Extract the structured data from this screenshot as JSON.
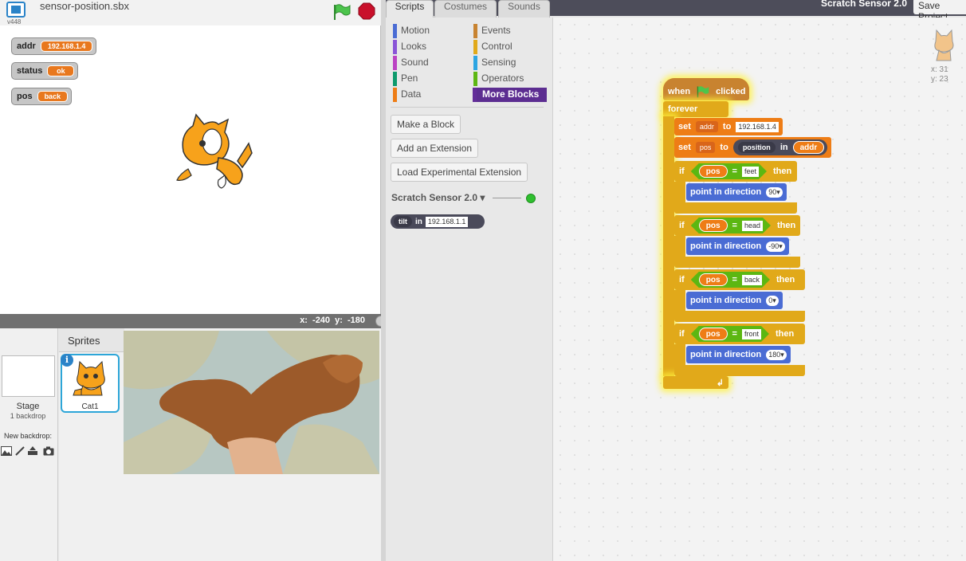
{
  "stage_panel": {
    "project_title": "sensor-position.sbx",
    "version": "v448",
    "monitors": [
      {
        "name": "addr",
        "value": "192.168.1.4"
      },
      {
        "name": "status",
        "value": "ok"
      },
      {
        "name": "pos",
        "value": "back"
      }
    ],
    "coords": {
      "x_label": "x:",
      "x": "-240",
      "y_label": "y:",
      "y": "-180"
    }
  },
  "sprites_pane": {
    "stage_label": "Stage",
    "stage_backdrops": "1 backdrop",
    "new_backdrop_label": "New backdrop:",
    "sprites_label": "Sprites",
    "info_glyph": "i",
    "sprite_name": "Cat1"
  },
  "tabs": [
    "Scripts",
    "Costumes",
    "Sounds"
  ],
  "header": {
    "app_title": "Scratch Sensor 2.0",
    "save_label": "Save Project"
  },
  "palette": {
    "categories": [
      {
        "label": "Motion",
        "color": "#4a6cd4"
      },
      {
        "label": "Events",
        "color": "#c88330"
      },
      {
        "label": "Looks",
        "color": "#8a55d7"
      },
      {
        "label": "Control",
        "color": "#e1a91a"
      },
      {
        "label": "Sound",
        "color": "#bb42c3"
      },
      {
        "label": "Sensing",
        "color": "#2ca5e2"
      },
      {
        "label": "Pen",
        "color": "#0e9a6c"
      },
      {
        "label": "Operators",
        "color": "#5cb712"
      },
      {
        "label": "Data",
        "color": "#ee7d16"
      },
      {
        "label": "More Blocks",
        "color": "#632d99"
      }
    ],
    "buttons": [
      "Make a Block",
      "Add an Extension",
      "Load Experimental Extension"
    ],
    "extension_title": "Scratch Sensor 2.0 ▾",
    "tilt_block": {
      "dropdown": "tilt",
      "in_label": "in",
      "addr": "192.168.1.1"
    }
  },
  "script": {
    "hat": {
      "when": "when",
      "clicked": "clicked"
    },
    "forever": "forever",
    "set_addr": {
      "set": "set",
      "var": "addr",
      "to": "to",
      "value": "192.168.1.4"
    },
    "set_pos": {
      "set": "set",
      "var": "pos",
      "to": "to",
      "reporter": "position",
      "in_label": "in",
      "arg": "addr"
    },
    "ifs": [
      {
        "if": "if",
        "var": "pos",
        "eq": "=",
        "cmp": "feet",
        "then": "then",
        "action": "point in direction",
        "dir": "90▾"
      },
      {
        "if": "if",
        "var": "pos",
        "eq": "=",
        "cmp": "head",
        "then": "then",
        "action": "point in direction",
        "dir": "-90▾"
      },
      {
        "if": "if",
        "var": "pos",
        "eq": "=",
        "cmp": "back",
        "then": "then",
        "action": "point in direction",
        "dir": "0▾"
      },
      {
        "if": "if",
        "var": "pos",
        "eq": "=",
        "cmp": "front",
        "then": "then",
        "action": "point in direction",
        "dir": "180▾"
      }
    ],
    "loop_arrow": "↲"
  },
  "sprite_info": {
    "x": "x: 31",
    "y": "y: 23"
  }
}
